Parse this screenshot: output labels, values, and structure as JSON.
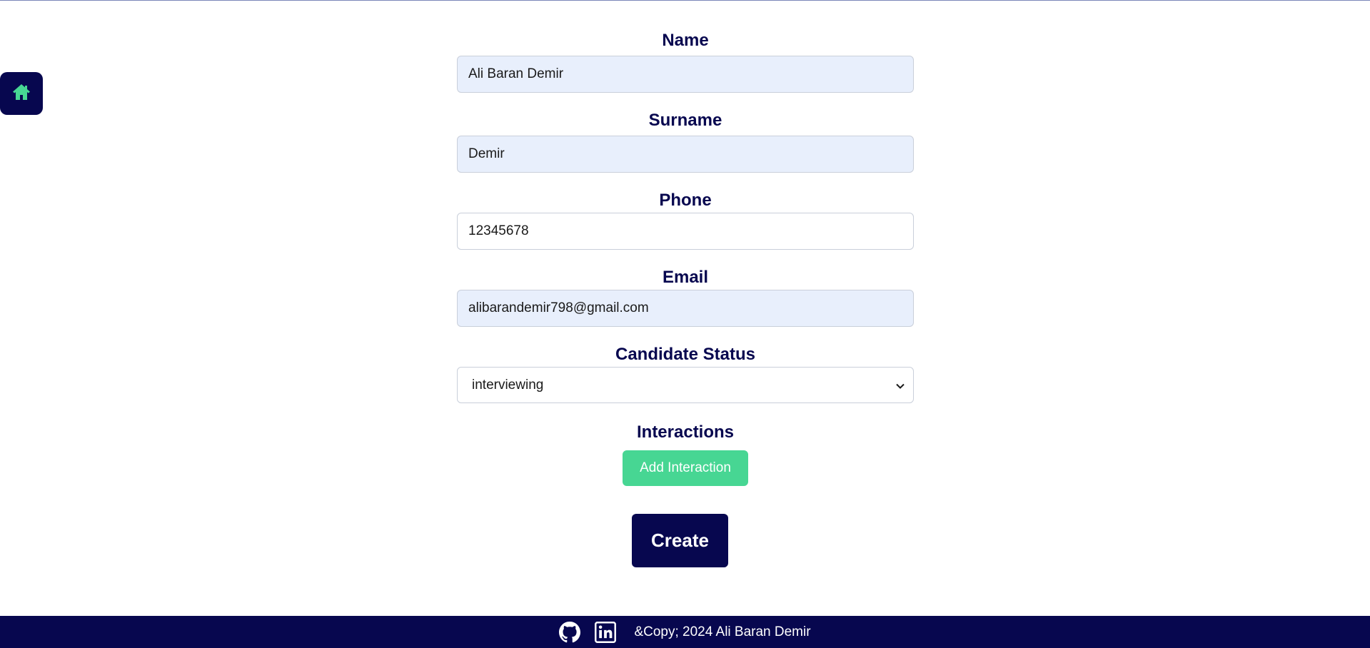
{
  "home": {
    "icon": "home-icon"
  },
  "form": {
    "name": {
      "label": "Name",
      "value": "Ali Baran Demir"
    },
    "surname": {
      "label": "Surname",
      "value": "Demir"
    },
    "phone": {
      "label": "Phone",
      "value": "12345678"
    },
    "email": {
      "label": "Email",
      "value": "alibarandemir798@gmail.com"
    },
    "status": {
      "label": "Candidate Status",
      "selected": "interviewing"
    },
    "interactions": {
      "label": "Interactions",
      "add_label": "Add Interaction"
    },
    "create_label": "Create"
  },
  "footer": {
    "icons": [
      "github-icon",
      "linkedin-icon"
    ],
    "copyright": "&Copy; 2024 Ali Baran Demir"
  },
  "colors": {
    "navy": "#07074f",
    "accent_green": "#47d693",
    "autofill_bg": "#e8effc"
  }
}
